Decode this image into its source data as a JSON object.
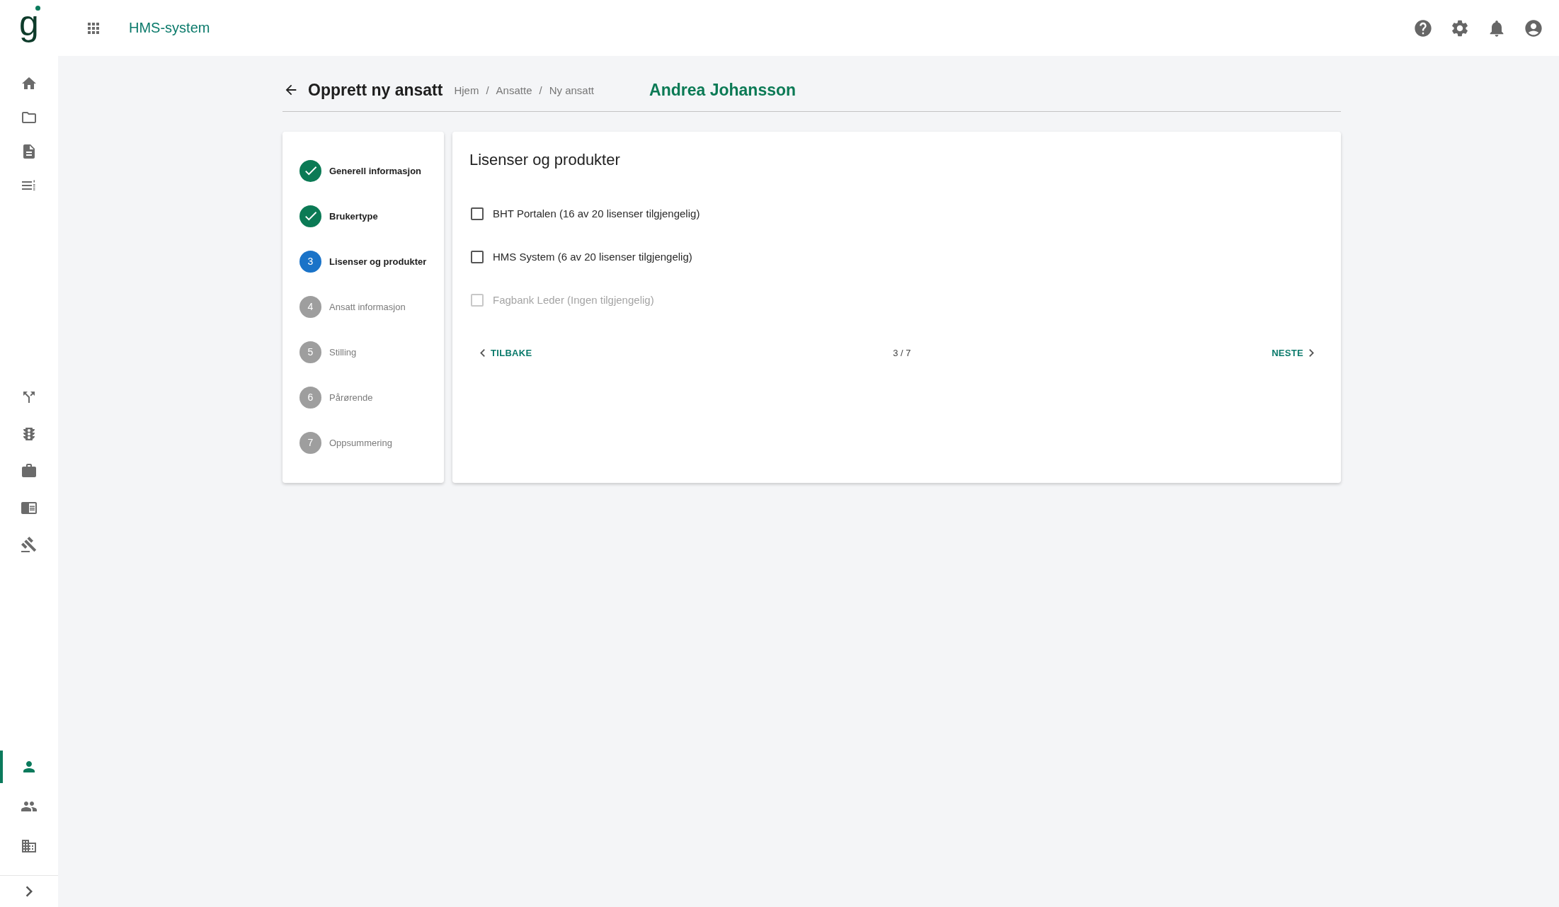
{
  "app": {
    "logo": "g",
    "title": "HMS-system"
  },
  "sidebar": {
    "sections": [
      {
        "items": [
          {
            "kind": "home",
            "selected": false
          },
          {
            "kind": "folder",
            "selected": false
          },
          {
            "kind": "document",
            "selected": false
          },
          {
            "kind": "numbered-list",
            "selected": false
          }
        ]
      },
      {
        "items": [
          {
            "kind": "split",
            "selected": false
          },
          {
            "kind": "traffic-light",
            "selected": false
          },
          {
            "kind": "briefcase",
            "selected": false
          },
          {
            "kind": "book",
            "selected": false
          },
          {
            "kind": "gavel",
            "selected": false
          }
        ]
      },
      {
        "items": [
          {
            "kind": "person",
            "selected": true
          },
          {
            "kind": "people",
            "selected": false
          },
          {
            "kind": "building",
            "selected": false
          }
        ]
      }
    ]
  },
  "header": {
    "title": "Opprett ny ansatt",
    "breadcrumbs": [
      "Hjem",
      "Ansatte",
      "Ny ansatt"
    ],
    "breadcrumb_separator": "/",
    "employee_name": "Andrea Johansson"
  },
  "stepper": {
    "steps": [
      {
        "label": "Generell informasjon",
        "kind": "done"
      },
      {
        "label": "Brukertype",
        "kind": "done"
      },
      {
        "number": "3",
        "label": "Lisenser og produkter",
        "kind": "active"
      },
      {
        "number": "4",
        "label": "Ansatt informasjon",
        "kind": "pending"
      },
      {
        "number": "5",
        "label": "Stilling",
        "kind": "pending"
      },
      {
        "number": "6",
        "label": "Pårørende",
        "kind": "pending"
      },
      {
        "number": "7",
        "label": "Oppsummering",
        "kind": "pending"
      }
    ]
  },
  "licenses": {
    "title": "Lisenser og produkter",
    "items": [
      {
        "label": "BHT Portalen (16 av 20 lisenser tilgjengelig)",
        "checked": false,
        "disabled": false
      },
      {
        "label": "HMS System (6 av 20 lisenser tilgjengelig)",
        "checked": false,
        "disabled": false
      },
      {
        "label": "Fagbank Leder (Ingen tilgjengelig)",
        "checked": false,
        "disabled": true
      }
    ]
  },
  "navigation": {
    "back": "TILBAKE",
    "step_counter": "3 / 7",
    "next": "NESTE"
  }
}
